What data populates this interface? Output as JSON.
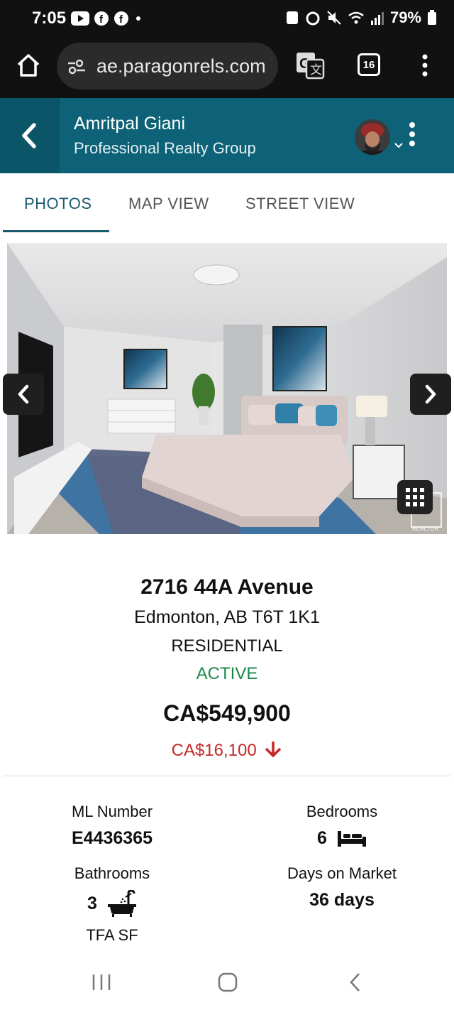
{
  "status_bar": {
    "time": "7:05",
    "battery": "79%"
  },
  "browser": {
    "url": "ae.paragonrels.com",
    "tab_count": "16"
  },
  "header": {
    "agent_name": "Amritpal Giani",
    "company": "Professional Realty Group"
  },
  "tabs": [
    {
      "label": "PHOTOS",
      "active": true
    },
    {
      "label": "MAP VIEW",
      "active": false
    },
    {
      "label": "STREET VIEW",
      "active": false
    }
  ],
  "photo": {
    "watermark": "REALTOR"
  },
  "listing": {
    "address_line1": "2716 44A Avenue",
    "address_line2": "Edmonton, AB T6T 1K1",
    "property_type": "RESIDENTIAL",
    "status": "ACTIVE",
    "price": "CA$549,900",
    "price_change": "CA$16,100"
  },
  "stats": {
    "ml_number": {
      "label": "ML Number",
      "value": "E4436365"
    },
    "bedrooms": {
      "label": "Bedrooms",
      "value": "6"
    },
    "bathrooms": {
      "label": "Bathrooms",
      "value": "3"
    },
    "days_on_market": {
      "label": "Days on Market",
      "value": "36 days"
    },
    "tfa": {
      "label": "TFA SF"
    }
  },
  "colors": {
    "header_bg": "#0e6277",
    "active_tab": "#1b5b70",
    "status_active": "#1b8a4a",
    "price_drop": "#c62828"
  },
  "icons": [
    "home-icon",
    "site-settings-icon",
    "translate-icon",
    "tab-switcher-icon",
    "more-vert-icon",
    "back-chevron-icon",
    "bed-icon",
    "bathtub-icon",
    "grid-icon",
    "arrow-down-icon"
  ]
}
